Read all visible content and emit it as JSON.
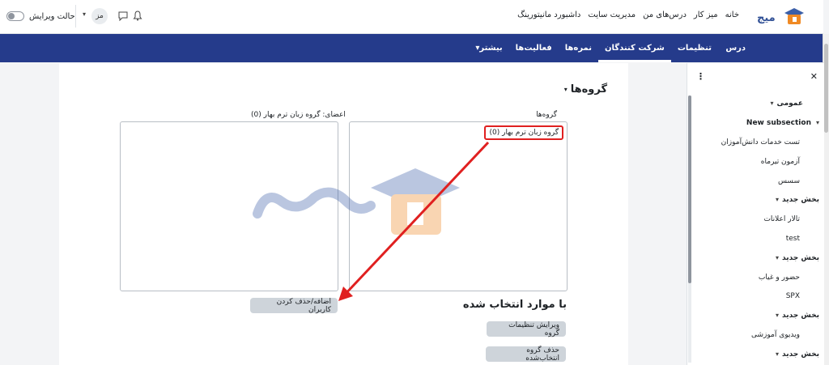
{
  "topbar": {
    "nav": [
      "خانه",
      "میز کار",
      "درس‌های من",
      "مدیریت سایت",
      "داشبورد مانیتورینگ"
    ],
    "edit_mode": "حالت ویرایش",
    "user_initials": "مز"
  },
  "mainnav": {
    "course": "درس",
    "tabs": [
      {
        "label": "تنظیمات",
        "active": false
      },
      {
        "label": "شرکت کنندگان",
        "active": true
      },
      {
        "label": "نمره‌ها",
        "active": false
      },
      {
        "label": "فعالیت‌ها",
        "active": false
      },
      {
        "label": "بیشتر",
        "active": false
      }
    ]
  },
  "content": {
    "heading": "گروه‌ها",
    "groups_label": "گروه‌ها",
    "members_label": "اعضای: گروه زبان ترم بهار (0)",
    "group_option": "گروه زبان ترم بهار (0)",
    "add_remove_button": "اضافه/حذف کردن کاربران",
    "selected_heading": "با موارد انتخاب شده",
    "edit_group_button": "ویرایش تنظیمات گروه",
    "delete_group_button": "حذف گروه انتخاب‌شده"
  },
  "sidebar": {
    "items": [
      {
        "label": "عمومی",
        "bold": true,
        "chevron": true
      },
      {
        "label": "New subsection",
        "bold": true,
        "chevron": true
      },
      {
        "label": "تست خدمات دانش‌آموزان",
        "bold": false,
        "chevron": false
      },
      {
        "label": "آزمون تیرماه",
        "bold": false,
        "chevron": false
      },
      {
        "label": "سسس",
        "bold": false,
        "chevron": false
      },
      {
        "label": "بخش جدید",
        "bold": true,
        "chevron": true
      },
      {
        "label": "تالار اعلانات",
        "bold": false,
        "chevron": false
      },
      {
        "label": "test",
        "bold": false,
        "chevron": false
      },
      {
        "label": "بخش جدید",
        "bold": true,
        "chevron": true
      },
      {
        "label": "حضور و غیاب",
        "bold": false,
        "chevron": false
      },
      {
        "label": "SPX",
        "bold": false,
        "chevron": false
      },
      {
        "label": "بخش جدید",
        "bold": true,
        "chevron": true
      },
      {
        "label": "ویدیوی آموزشی",
        "bold": false,
        "chevron": false
      },
      {
        "label": "بخش جدید",
        "bold": true,
        "chevron": true
      }
    ]
  },
  "colors": {
    "nav_bg": "#253b8b",
    "highlight_red": "#e02020",
    "button_bg": "#ced4da"
  },
  "icons": [
    "logo",
    "bell-icon",
    "message-icon",
    "close-icon",
    "kebab-menu-icon",
    "chevron-down-icon",
    "arrow-annotation"
  ]
}
